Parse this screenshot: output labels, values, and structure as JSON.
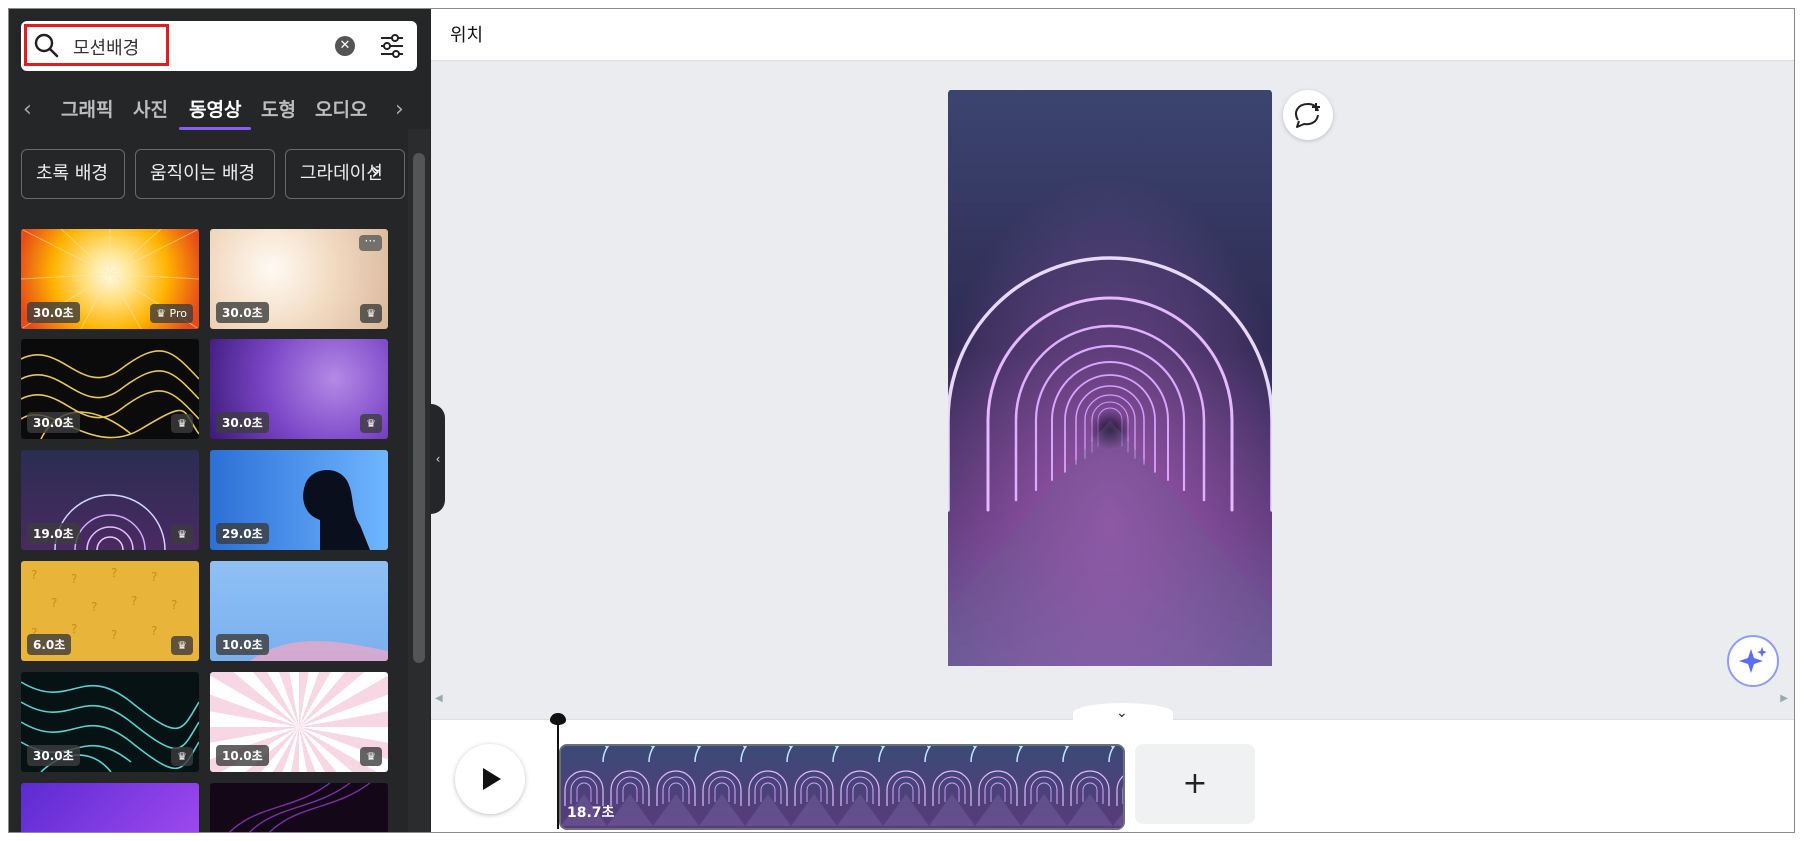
{
  "search": {
    "query": "모션배경"
  },
  "tabs": [
    "그래픽",
    "사진",
    "동영상",
    "도형",
    "오디오"
  ],
  "active_tab": "동영상",
  "chips": [
    "초록 배경",
    "움직이는 배경",
    "그라데이션"
  ],
  "thumbnails": [
    {
      "duration": "30.0초",
      "badge": "Pro"
    },
    {
      "duration": "30.0초",
      "badge": ""
    },
    {
      "duration": "30.0초",
      "badge": ""
    },
    {
      "duration": "30.0초",
      "badge": ""
    },
    {
      "duration": "19.0초",
      "badge": ""
    },
    {
      "duration": "29.0초",
      "badge": ""
    },
    {
      "duration": "6.0초",
      "badge": ""
    },
    {
      "duration": "10.0초",
      "badge": ""
    },
    {
      "duration": "30.0초",
      "badge": ""
    },
    {
      "duration": "10.0초",
      "badge": ""
    }
  ],
  "topbar": {
    "title": "위치"
  },
  "timeline": {
    "clip_duration": "18.7초",
    "add_label": "+"
  },
  "colors": {
    "sidebar": "#252627",
    "canvas_bg": "#ebecf0",
    "accent": "#8b5cf6",
    "highlight": "#e31b23"
  }
}
